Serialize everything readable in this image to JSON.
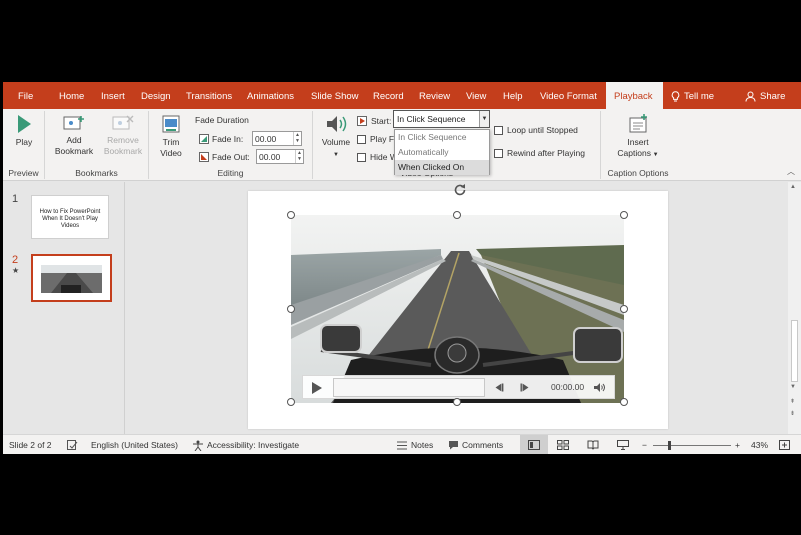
{
  "menu": {
    "tabs": [
      "File",
      "Home",
      "Insert",
      "Design",
      "Transitions",
      "Animations",
      "Slide Show",
      "Record",
      "Review",
      "View",
      "Help",
      "Video Format",
      "Playback"
    ],
    "active_tab": "Playback",
    "tell_me": "Tell me",
    "share": "Share"
  },
  "ribbon": {
    "preview": {
      "label": "Preview",
      "play": "Play"
    },
    "bookmarks": {
      "label": "Bookmarks",
      "add_line1": "Add",
      "add_line2": "Bookmark",
      "remove_line1": "Remove",
      "remove_line2": "Bookmark"
    },
    "editing": {
      "label": "Editing",
      "trim_line1": "Trim",
      "trim_line2": "Video",
      "fade_duration": "Fade Duration",
      "fade_in_label": "Fade In:",
      "fade_in_value": "00.00",
      "fade_out_label": "Fade Out:",
      "fade_out_value": "00.00"
    },
    "video_options": {
      "label": "Video Options",
      "volume": "Volume",
      "start_label": "Start:",
      "start_value": "In Click Sequence",
      "start_options": [
        "In Click Sequence",
        "Automatically",
        "When Clicked On"
      ],
      "hovered_option": "When Clicked On",
      "play_full": "Play Fu",
      "hide_while": "Hide W",
      "loop": "Loop until Stopped",
      "rewind": "Rewind after Playing"
    },
    "caption_options": {
      "label": "Caption Options",
      "insert_line1": "Insert",
      "insert_line2": "Captions"
    }
  },
  "slides": [
    {
      "number": "1",
      "title": "How to Fix PowerPoint When It Doesn't Play Videos"
    },
    {
      "number": "2",
      "marker": "★"
    }
  ],
  "player": {
    "time": "00:00.00"
  },
  "status": {
    "slide_info": "Slide 2 of 2",
    "language": "English (United States)",
    "accessibility": "Accessibility: Investigate",
    "notes": "Notes",
    "comments": "Comments",
    "zoom": "43%"
  },
  "colors": {
    "accent": "#c43e1c",
    "ribbon_bg": "#f3f2f1",
    "workspace_bg": "#e6e6e6"
  }
}
